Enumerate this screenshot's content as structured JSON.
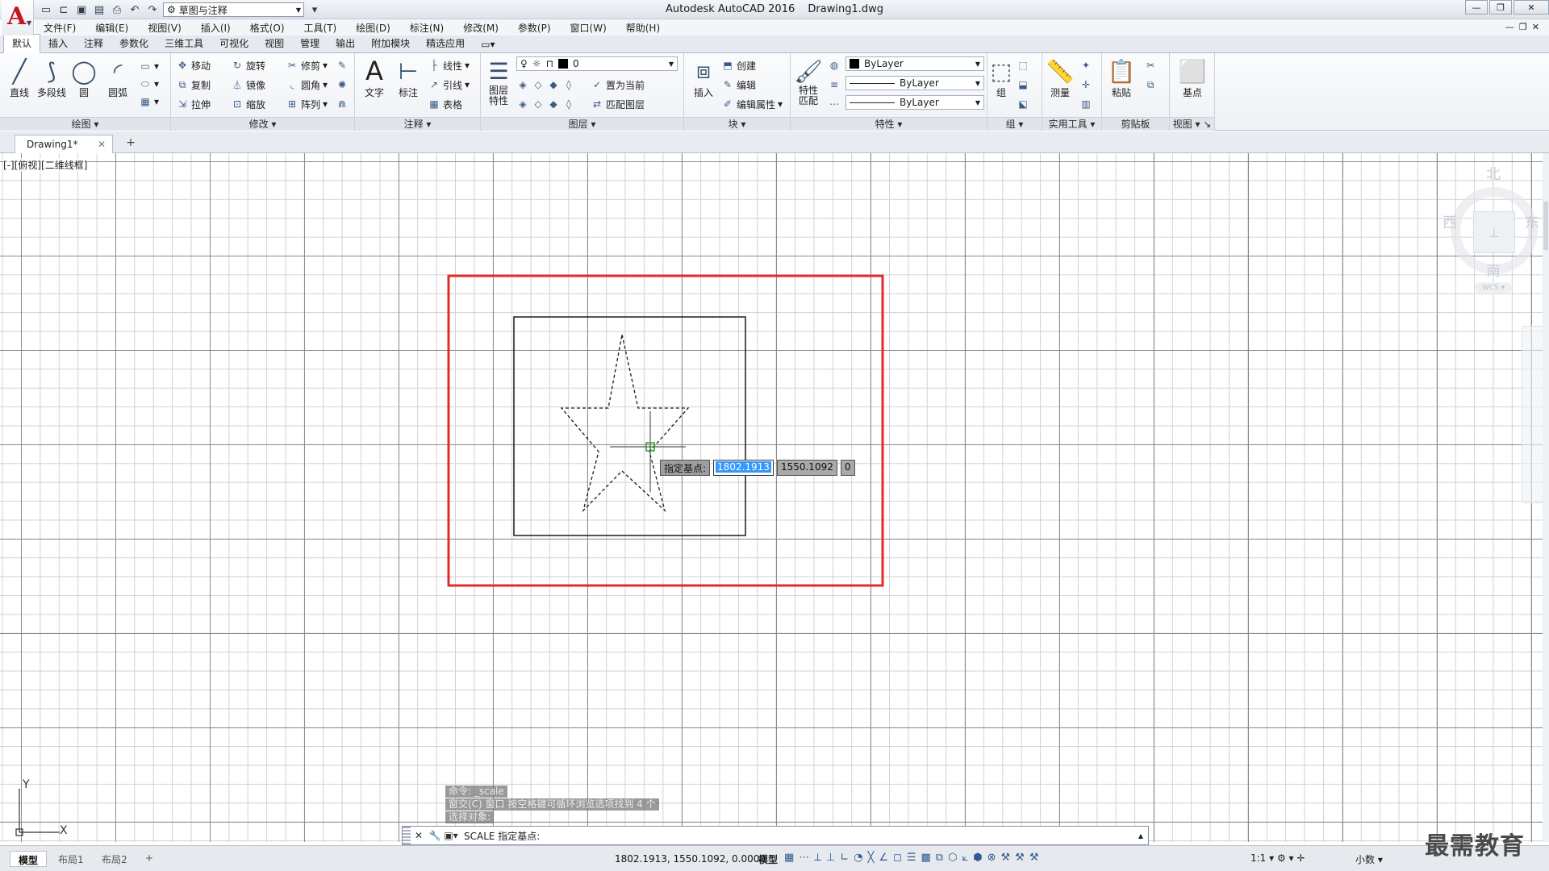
{
  "titlebar": {
    "app_name": "Autodesk AutoCAD 2016",
    "document": "Drawing1.dwg",
    "workspace": "草图与注释"
  },
  "menu": [
    "文件(F)",
    "编辑(E)",
    "视图(V)",
    "插入(I)",
    "格式(O)",
    "工具(T)",
    "绘图(D)",
    "标注(N)",
    "修改(M)",
    "参数(P)",
    "窗口(W)",
    "帮助(H)"
  ],
  "ribbon_tabs": [
    "默认",
    "插入",
    "注释",
    "参数化",
    "三维工具",
    "可视化",
    "视图",
    "管理",
    "输出",
    "附加模块",
    "精选应用"
  ],
  "panels": {
    "draw": {
      "title": "绘图",
      "line": "直线",
      "polyline": "多段线",
      "circle": "圆",
      "arc": "圆弧"
    },
    "modify": {
      "title": "修改",
      "move": "移动",
      "rotate": "旋转",
      "trim": "修剪",
      "copy": "复制",
      "mirror": "镜像",
      "fillet": "圆角",
      "stretch": "拉伸",
      "scale": "缩放",
      "array": "阵列"
    },
    "annotation": {
      "title": "注释",
      "text": "文字",
      "dimension": "标注",
      "linear": "线性",
      "leader": "引线",
      "table": "表格"
    },
    "layers": {
      "title": "图层",
      "layer_props_line1": "图层",
      "layer_props_line2": "特性",
      "current_layer": "0",
      "set_current": "置为当前",
      "match_layer": "匹配图层"
    },
    "block": {
      "title": "块",
      "insert": "插入",
      "create": "创建",
      "edit": "编辑",
      "edit_attr": "编辑属性"
    },
    "properties": {
      "title": "特性",
      "match_line1": "特性",
      "match_line2": "匹配",
      "color": "ByLayer",
      "linetype": "ByLayer",
      "lineweight": "ByLayer"
    },
    "group": {
      "title": "组",
      "group": "组"
    },
    "utilities": {
      "title": "实用工具",
      "measure": "测量"
    },
    "clipboard": {
      "title": "剪贴板",
      "paste": "粘贴"
    },
    "view": {
      "title": "视图",
      "base": "基点"
    }
  },
  "doc_tab": "Drawing1*",
  "viewport_label": "[-][俯视][二维线框]",
  "dynamic_input": {
    "prompt": "指定基点:",
    "x": "1802.1913",
    "y": "1550.1092",
    "z": "0"
  },
  "viewcube": {
    "north": "北",
    "south": "南",
    "east": "东",
    "west": "西",
    "wcs": "WCS"
  },
  "ucs": {
    "x": "X",
    "y": "Y"
  },
  "command_history": [
    "命令: _scale",
    "窗交(C) 窗口  按空格键可循环浏览选项找到 4 个",
    "选择对象:"
  ],
  "command_line": {
    "prompt": "SCALE 指定基点:"
  },
  "status": {
    "layouts": [
      "模型",
      "布局1",
      "布局2"
    ],
    "coords": "1802.1913, 1550.1092, 0.0000",
    "model": "模型",
    "scale": "1:1",
    "units": "小数"
  },
  "watermark": "最需教育",
  "colors": {
    "highlight_frame": "#e32b2b",
    "grid_major": "#8d8d8d",
    "grid_minor": "#d2d2d2",
    "selection": "#3399ff",
    "brand": "#c4161c"
  }
}
